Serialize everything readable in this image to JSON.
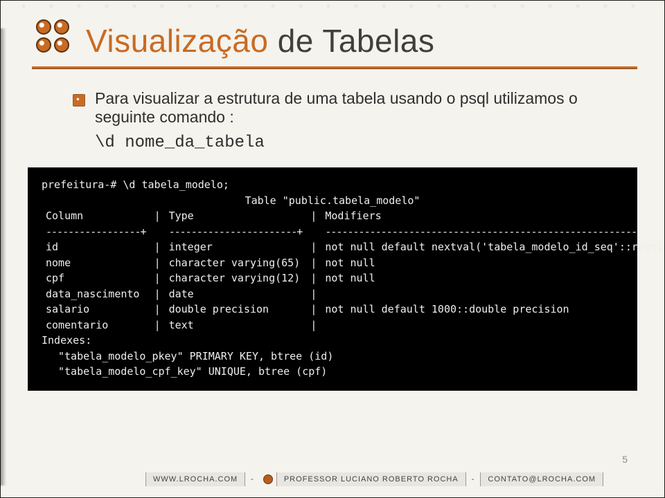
{
  "title": {
    "part1": "Visualização",
    "part2": "de Tabelas"
  },
  "body": {
    "bullet_text": "Para visualizar a estrutura de uma tabela usando o psql utilizamos o seguinte comando :",
    "code_example": "\\d nome_da_tabela"
  },
  "terminal": {
    "prompt": "prefeitura-# \\d tabela_modelo;",
    "table_header": "Table \"public.tabela_modelo\"",
    "col_headers": [
      "Column",
      "Type",
      "Modifiers"
    ],
    "rows": [
      {
        "column": "id",
        "type": "integer",
        "modifiers": "not null default nextval('tabela_modelo_id_seq'::regclass)"
      },
      {
        "column": "nome",
        "type": "character varying(65)",
        "modifiers": "not null"
      },
      {
        "column": "cpf",
        "type": "character varying(12)",
        "modifiers": "not null"
      },
      {
        "column": "data_nascimento",
        "type": "date",
        "modifiers": ""
      },
      {
        "column": "salario",
        "type": "double precision",
        "modifiers": "not null default 1000::double precision"
      },
      {
        "column": "comentario",
        "type": "text",
        "modifiers": ""
      }
    ],
    "indexes_label": "Indexes:",
    "indexes": [
      "\"tabela_modelo_pkey\" PRIMARY KEY, btree (id)",
      "\"tabela_modelo_cpf_key\" UNIQUE, btree (cpf)"
    ],
    "divider": {
      "c1": "-----------------+",
      "c2": "-----------------------+",
      "c3": "-----------------------------------------------------------"
    }
  },
  "footer": {
    "site": "WWW.LROCHA.COM",
    "prof": "PROFESSOR LUCIANO ROBERTO ROCHA",
    "mail": "CONTATO@LROCHA.COM"
  },
  "page_number": "5"
}
